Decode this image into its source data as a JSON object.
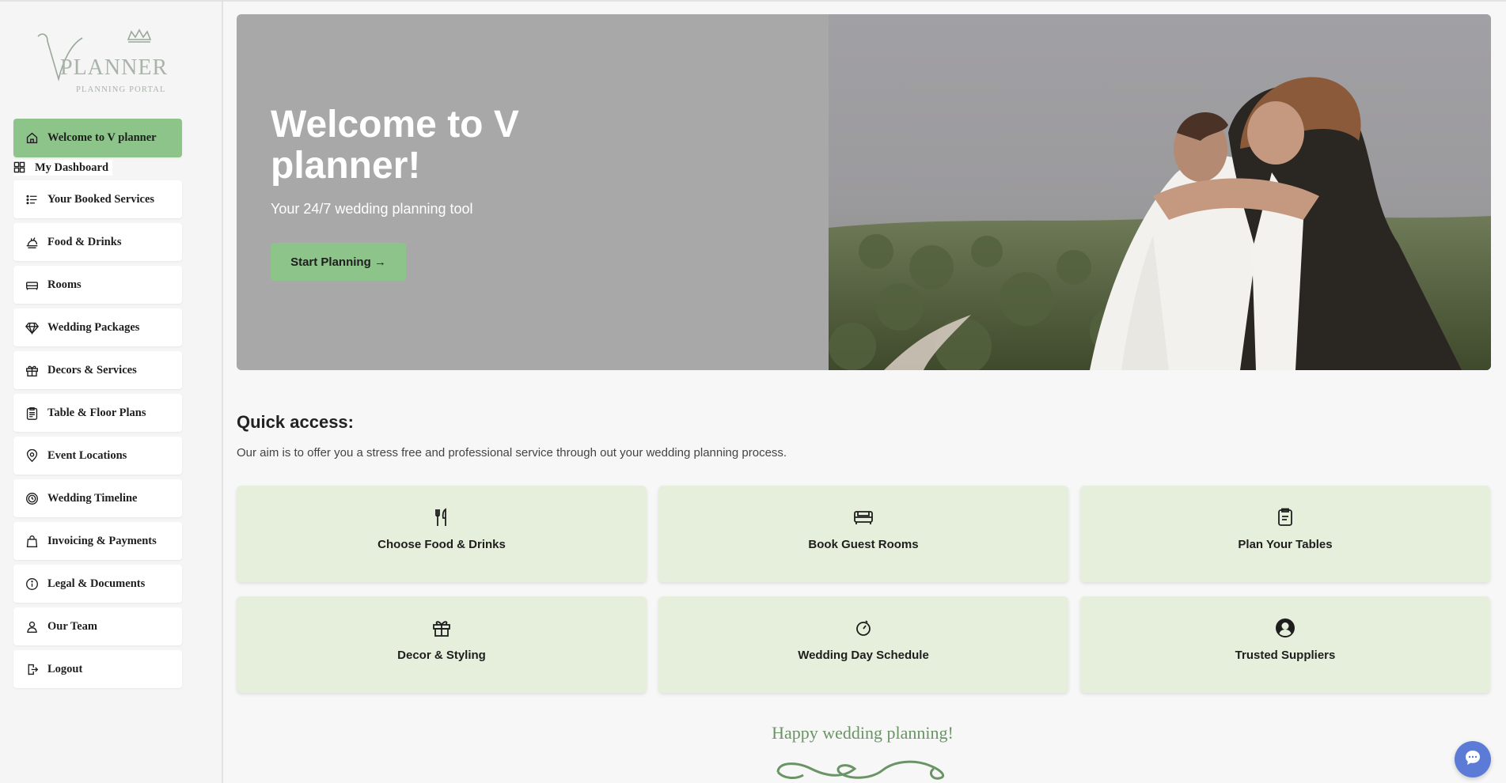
{
  "logo": {
    "text": "VPLANNER",
    "subtext": "PLANNING PORTAL"
  },
  "sidebar": {
    "active": {
      "label": "Welcome to V planner",
      "icon": "home-icon"
    },
    "dashboard": {
      "label": "My Dashboard",
      "icon": "dashboard-grid-icon"
    },
    "items": [
      {
        "label": "Your Booked Services",
        "icon": "list-icon"
      },
      {
        "label": "Food & Drinks",
        "icon": "food-icon"
      },
      {
        "label": "Rooms",
        "icon": "bed-icon"
      },
      {
        "label": "Wedding Packages",
        "icon": "diamond-icon"
      },
      {
        "label": "Decors & Services",
        "icon": "gift-icon"
      },
      {
        "label": "Table & Floor Plans",
        "icon": "clipboard-icon"
      },
      {
        "label": "Event Locations",
        "icon": "location-pin-icon"
      },
      {
        "label": "Wedding Timeline",
        "icon": "clock-icon"
      },
      {
        "label": "Invoicing & Payments",
        "icon": "bag-icon"
      },
      {
        "label": "Legal & Documents",
        "icon": "info-icon"
      },
      {
        "label": "Our Team",
        "icon": "person-icon"
      },
      {
        "label": "Logout",
        "icon": "logout-icon"
      }
    ]
  },
  "hero": {
    "title": "Welcome to V planner!",
    "subtitle": "Your 24/7 wedding planning tool",
    "button": "Start Planning →"
  },
  "quick_access": {
    "title": "Quick access:",
    "description": "Our aim is to offer you a stress free and professional service through out your wedding planning process.",
    "cards": [
      {
        "label": "Choose Food & Drinks",
        "icon": "fork-knife-icon"
      },
      {
        "label": "Book Guest Rooms",
        "icon": "bed-icon"
      },
      {
        "label": "Plan Your Tables",
        "icon": "clipboard-icon"
      },
      {
        "label": "Decor & Styling",
        "icon": "gift-icon"
      },
      {
        "label": "Wedding Day Schedule",
        "icon": "stopwatch-icon"
      },
      {
        "label": "Trusted Suppliers",
        "icon": "user-circle-icon"
      }
    ]
  },
  "footer": {
    "text": "Happy wedding planning!"
  },
  "colors": {
    "accent": "#8dc48a",
    "card_bg": "#e6efdc",
    "hero_bg": "#a8a8a8",
    "chat": "#5b7bd6",
    "script_text": "#6b9466"
  }
}
